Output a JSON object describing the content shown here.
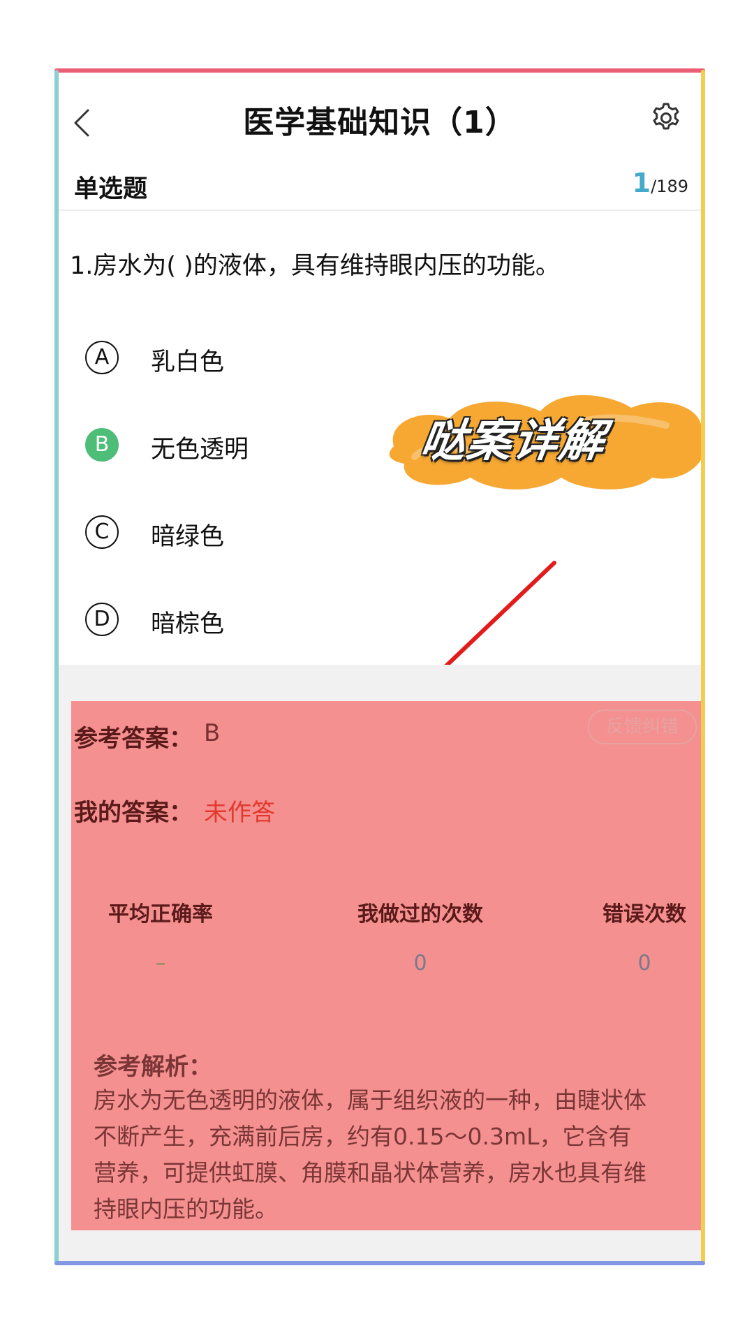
{
  "header": {
    "title": "医学基础知识（1）",
    "back_icon": "chevron-left-icon",
    "settings_icon": "gear-icon"
  },
  "question_bar": {
    "type": "单选题",
    "current": "1",
    "total": "/189"
  },
  "question": {
    "text": "1.房水为( )的液体，具有维持眼内压的功能。",
    "options": [
      {
        "letter": "A",
        "label": "乳白色",
        "correct": false
      },
      {
        "letter": "B",
        "label": "无色透明",
        "correct": true
      },
      {
        "letter": "C",
        "label": "暗绿色",
        "correct": false
      },
      {
        "letter": "D",
        "label": "暗棕色",
        "correct": false
      }
    ]
  },
  "overlay": {
    "sticker_text": "哒案详解",
    "sticker_color": "#f6a833",
    "arrow_color": "#e31b1b"
  },
  "answer_panel": {
    "ref_label": "参考答案：",
    "ref_value": "B",
    "feedback_button": "反馈纠错",
    "my_label": "我的答案：",
    "my_value": "未作答",
    "stats": [
      {
        "label": "平均正确率",
        "value": "–"
      },
      {
        "label": "我做过的次数",
        "value": "0"
      },
      {
        "label": "错误次数",
        "value": "0"
      }
    ],
    "analysis_title": "参考解析：",
    "analysis_text": "房水为无色透明的液体，属于组织液的一种，由睫状体不断产生，充满前后房，约有0.15～0.3mL，它含有营养，可提供虹膜、角膜和晶状体营养，房水也具有维持眼内压的功能。",
    "panel_color": "#f59090"
  },
  "frame_colors": {
    "top": "#ec5e75",
    "left": "#8ccfcf",
    "right": "#f4cc4f",
    "bottom": "#8497e2"
  }
}
